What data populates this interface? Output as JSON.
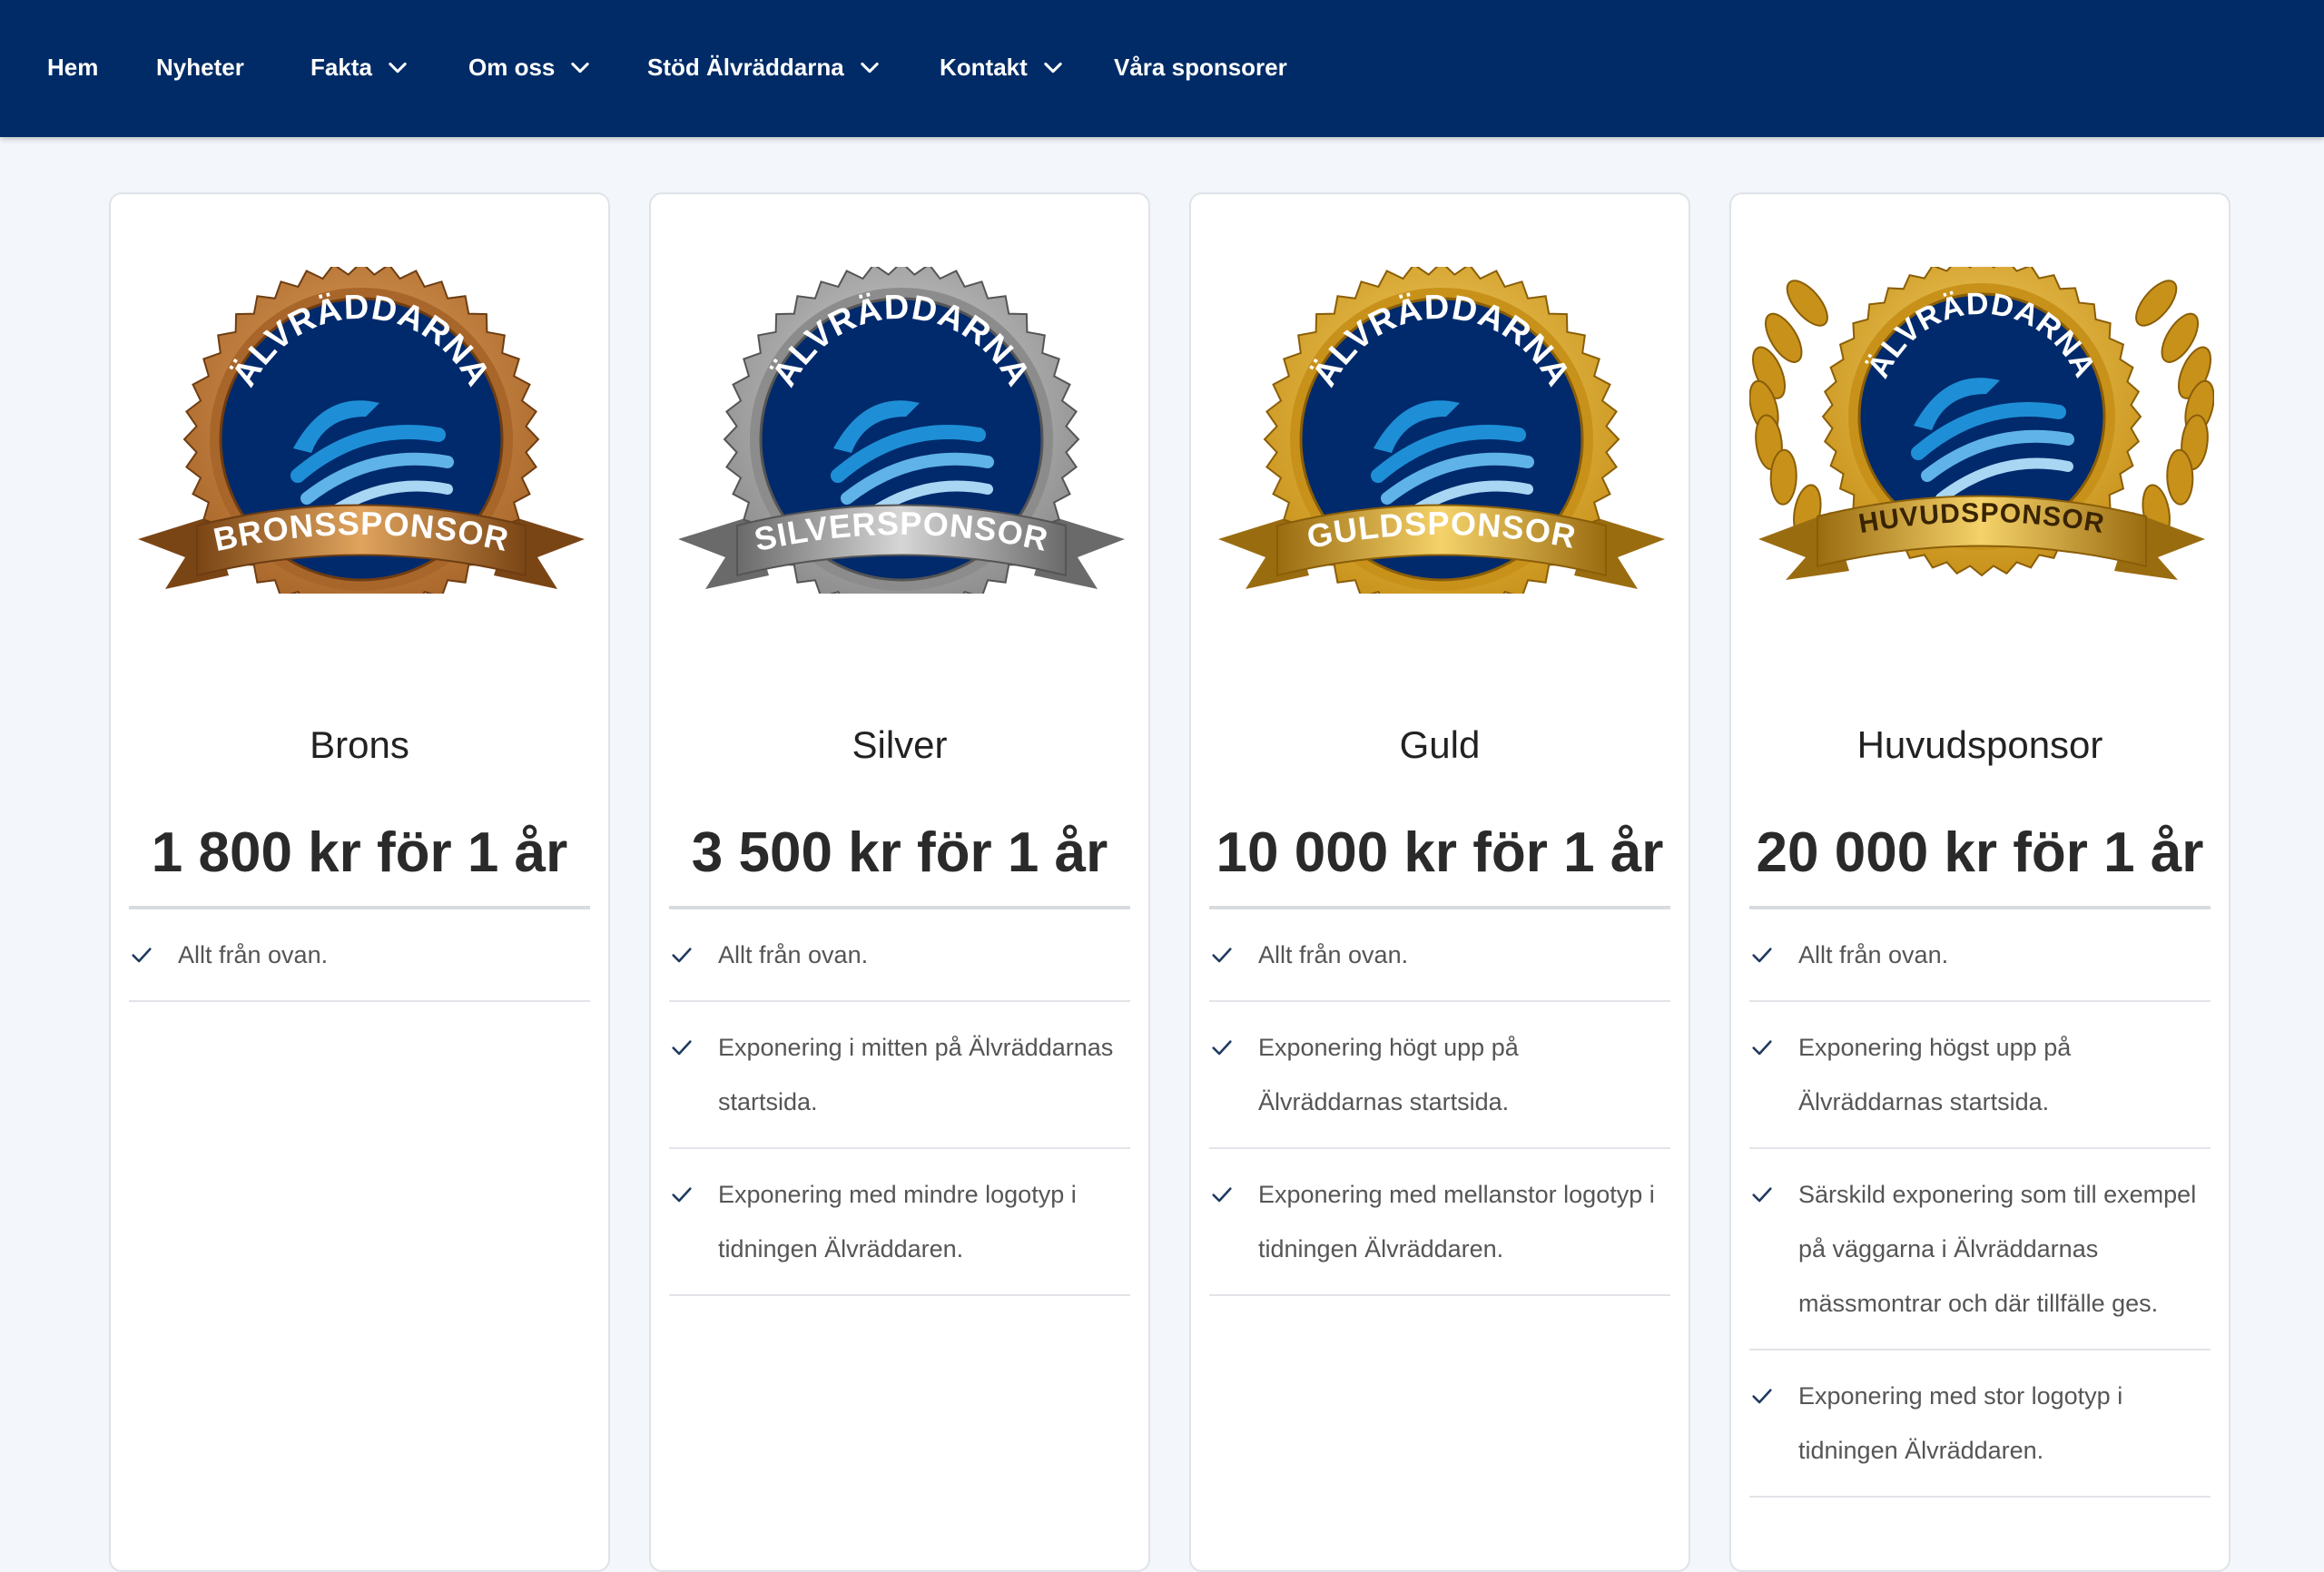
{
  "nav": {
    "items": [
      {
        "label": "Hem",
        "dropdown": false
      },
      {
        "label": "Nyheter",
        "dropdown": false
      },
      {
        "label": "Fakta",
        "dropdown": true
      },
      {
        "label": "Om oss",
        "dropdown": true
      },
      {
        "label": "Stöd Älvräddarna",
        "dropdown": true
      },
      {
        "label": "Kontakt",
        "dropdown": true
      },
      {
        "label": "Våra sponsorer",
        "dropdown": false
      }
    ]
  },
  "colors": {
    "nav_bg": "#002b66",
    "page_bg": "#f3f7fb",
    "badge_navy": "#012a6c",
    "bronze": "#b8742f",
    "silver": "#9a9a9a",
    "gold": "#d9a624",
    "check": "#1f3a5f"
  },
  "cards": [
    {
      "badge": {
        "arc_text": "ÄLVRÄDDARNA",
        "ribbon_text": "BRONSSPONSOR",
        "style": "bronze",
        "icon": "dolphin-wave-logo"
      },
      "name": "Brons",
      "price": "1 800 kr för 1 år",
      "features": [
        "Allt från ovan."
      ]
    },
    {
      "badge": {
        "arc_text": "ÄLVRÄDDARNA",
        "ribbon_text": "SILVERSPONSOR",
        "style": "silver",
        "icon": "dolphin-wave-logo"
      },
      "name": "Silver",
      "price": "3 500 kr för 1 år",
      "features": [
        "Allt från ovan.",
        "Exponering i mitten på Älvräddarnas startsida.",
        "Exponering med mindre logotyp i tidningen Älvräddaren."
      ]
    },
    {
      "badge": {
        "arc_text": "ÄLVRÄDDARNA",
        "ribbon_text": "GULDSPONSOR",
        "style": "gold",
        "icon": "dolphin-wave-logo"
      },
      "name": "Guld",
      "price": "10 000 kr för 1 år",
      "features": [
        "Allt från ovan.",
        "Exponering högt upp på Älvräddarnas startsida.",
        "Exponering med mellanstor logotyp i tidningen Älvräddaren."
      ]
    },
    {
      "badge": {
        "arc_text": "ÄLVRÄDDARNA",
        "ribbon_text": "HUVUDSPONSOR",
        "style": "gold-laurel",
        "icon": "dolphin-wave-logo"
      },
      "name": "Huvudsponsor",
      "price": "20 000 kr för 1 år",
      "features": [
        "Allt från ovan.",
        "Exponering högst upp på Älvräddarnas startsida.",
        "Särskild exponering som till exempel på väggarna i Älvräddarnas mässmontrar och där tillfälle ges.",
        "Exponering med stor logotyp i tidningen Älvräddaren."
      ]
    }
  ]
}
